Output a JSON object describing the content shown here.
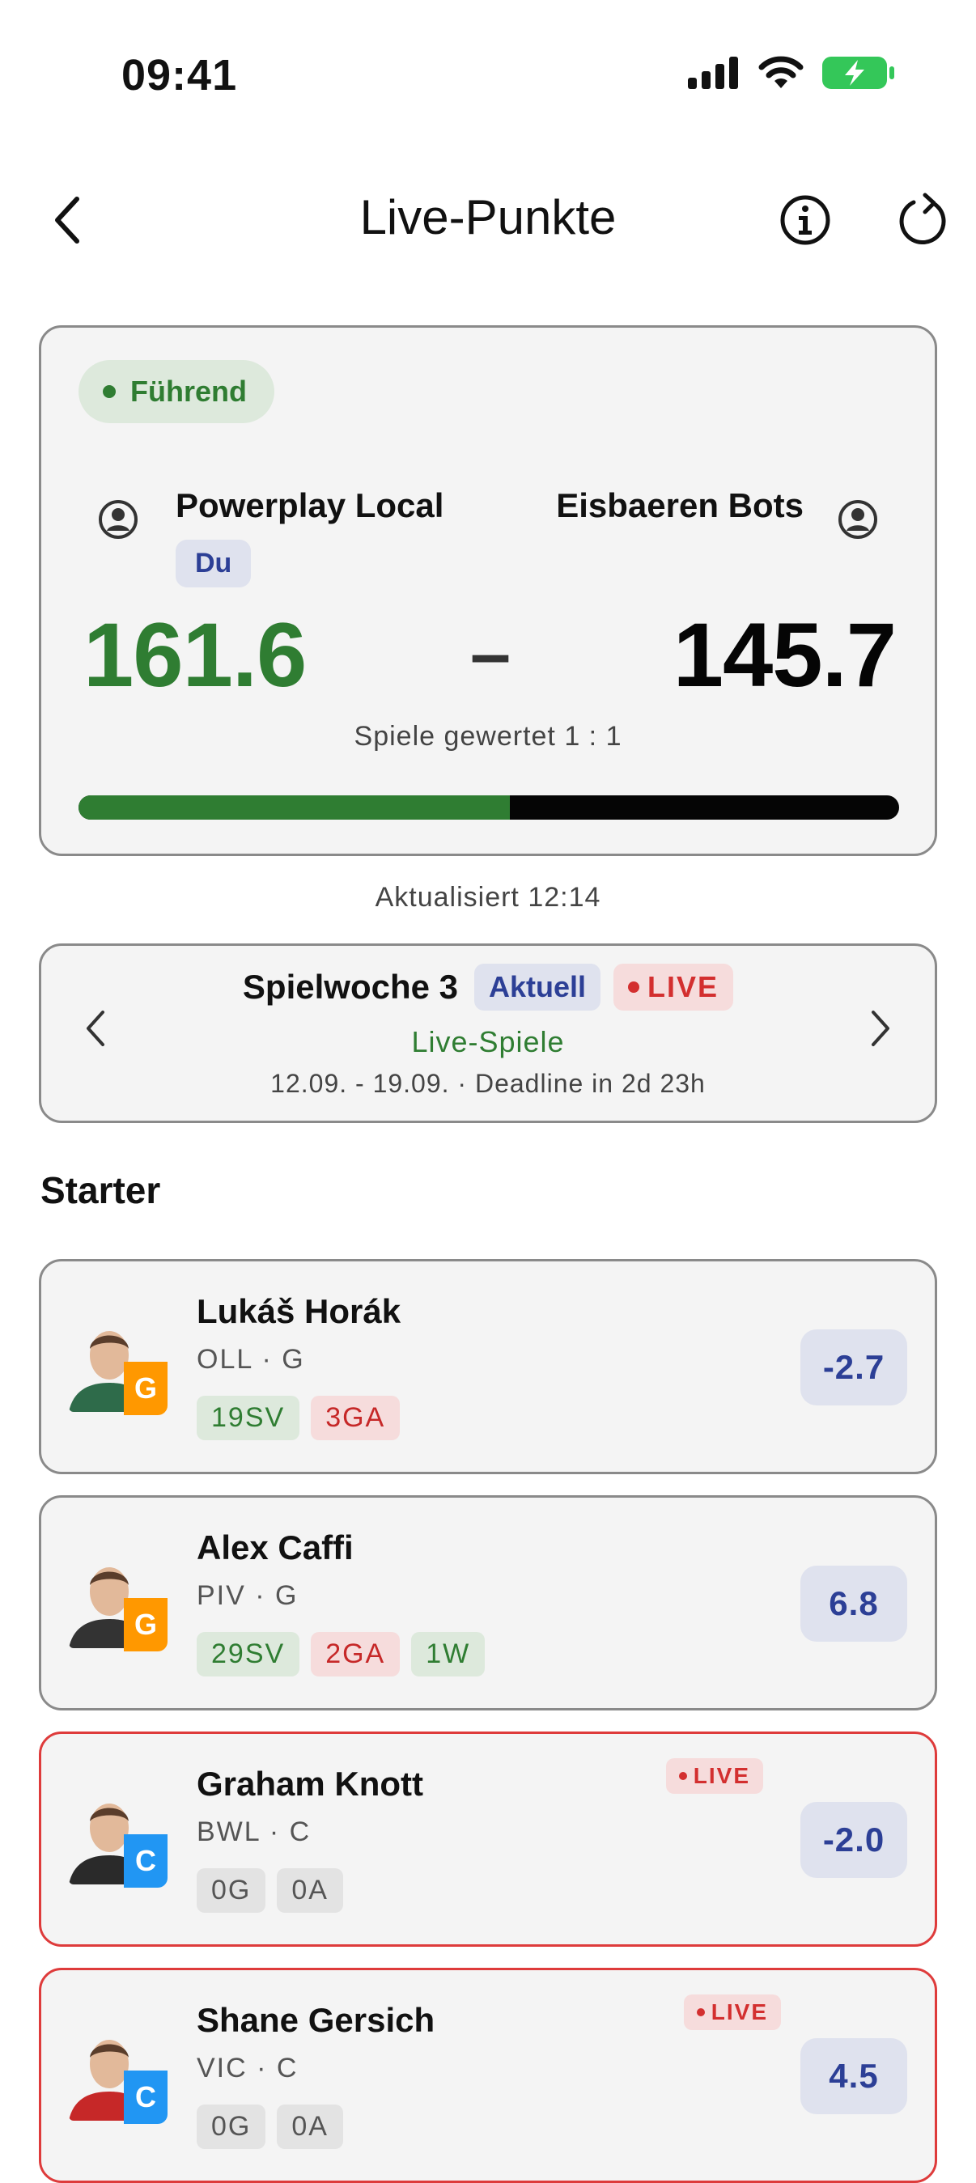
{
  "status_bar": {
    "time": "09:41"
  },
  "nav": {
    "title": "Live-Punkte"
  },
  "matchup": {
    "lead_label": "Führend",
    "home": {
      "name": "Powerplay Local",
      "you_badge": "Du",
      "score": "161.6"
    },
    "away": {
      "name": "Eisbaeren Bots",
      "score": "145.7"
    },
    "separator": "–",
    "games_scored": "Spiele gewertet 1 : 1",
    "progress_fraction": 0.526,
    "colors": {
      "home": "#2f7d32",
      "away": "#050505"
    }
  },
  "updated": "Aktualisiert 12:14",
  "week": {
    "title": "Spielwoche 3",
    "current_badge": "Aktuell",
    "live_badge": "LIVE",
    "subtitle": "Live-Spiele",
    "dates": "12.09. - 19.09. · Deadline in 2d 23h"
  },
  "section_title": "Starter",
  "players": [
    {
      "name": "Lukáš Horák",
      "meta": "OLL · G",
      "pos": "G",
      "pos_color": "#ff9800",
      "live": false,
      "stats": [
        {
          "label": "19SV",
          "tone": "green"
        },
        {
          "label": "3GA",
          "tone": "red"
        }
      ],
      "points": "-2.7"
    },
    {
      "name": "Alex Caffi",
      "meta": "PIV · G",
      "pos": "G",
      "pos_color": "#ff9800",
      "live": false,
      "stats": [
        {
          "label": "29SV",
          "tone": "green"
        },
        {
          "label": "2GA",
          "tone": "red"
        },
        {
          "label": "1W",
          "tone": "green"
        }
      ],
      "points": "6.8"
    },
    {
      "name": "Graham Knott",
      "meta": "BWL · C",
      "pos": "C",
      "pos_color": "#2196f3",
      "live": true,
      "live_label": "LIVE",
      "stats": [
        {
          "label": "0G",
          "tone": "grey"
        },
        {
          "label": "0A",
          "tone": "grey"
        }
      ],
      "points": "-2.0"
    },
    {
      "name": "Shane Gersich",
      "meta": "VIC · C",
      "pos": "C",
      "pos_color": "#2196f3",
      "live": true,
      "live_label": "LIVE",
      "stats": [
        {
          "label": "0G",
          "tone": "grey"
        },
        {
          "label": "0A",
          "tone": "grey"
        }
      ],
      "points": "4.5"
    }
  ]
}
